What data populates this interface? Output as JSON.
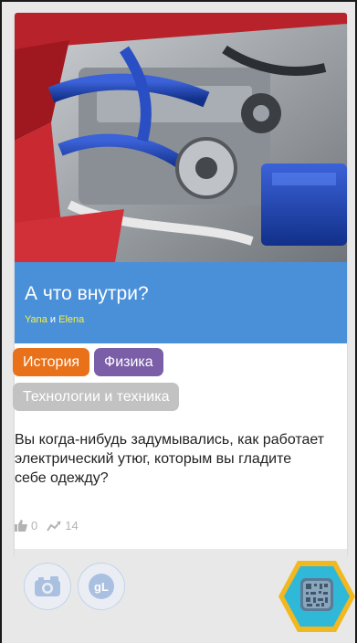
{
  "card": {
    "title": "А что внутри?",
    "authors": {
      "first": "Yana",
      "connector": " и ",
      "second": "Elena"
    },
    "tags": [
      "История",
      "Физика",
      "Технологии и техника"
    ],
    "description": "Вы когда-нибудь задумывались, как работает электрический утюг, которым вы гладите себе одежду?",
    "likes": "0",
    "views": "14"
  },
  "colors": {
    "title_band": "#4a90d9",
    "author_link": "#f5f03a",
    "tag_history": "#e8711a",
    "tag_physics": "#7b5ea8",
    "tag_tech": "#c2c2c2"
  },
  "icons": [
    "thumbs-up-icon",
    "trend-icon",
    "camera-icon",
    "gl-icon",
    "qr-badge-icon"
  ]
}
